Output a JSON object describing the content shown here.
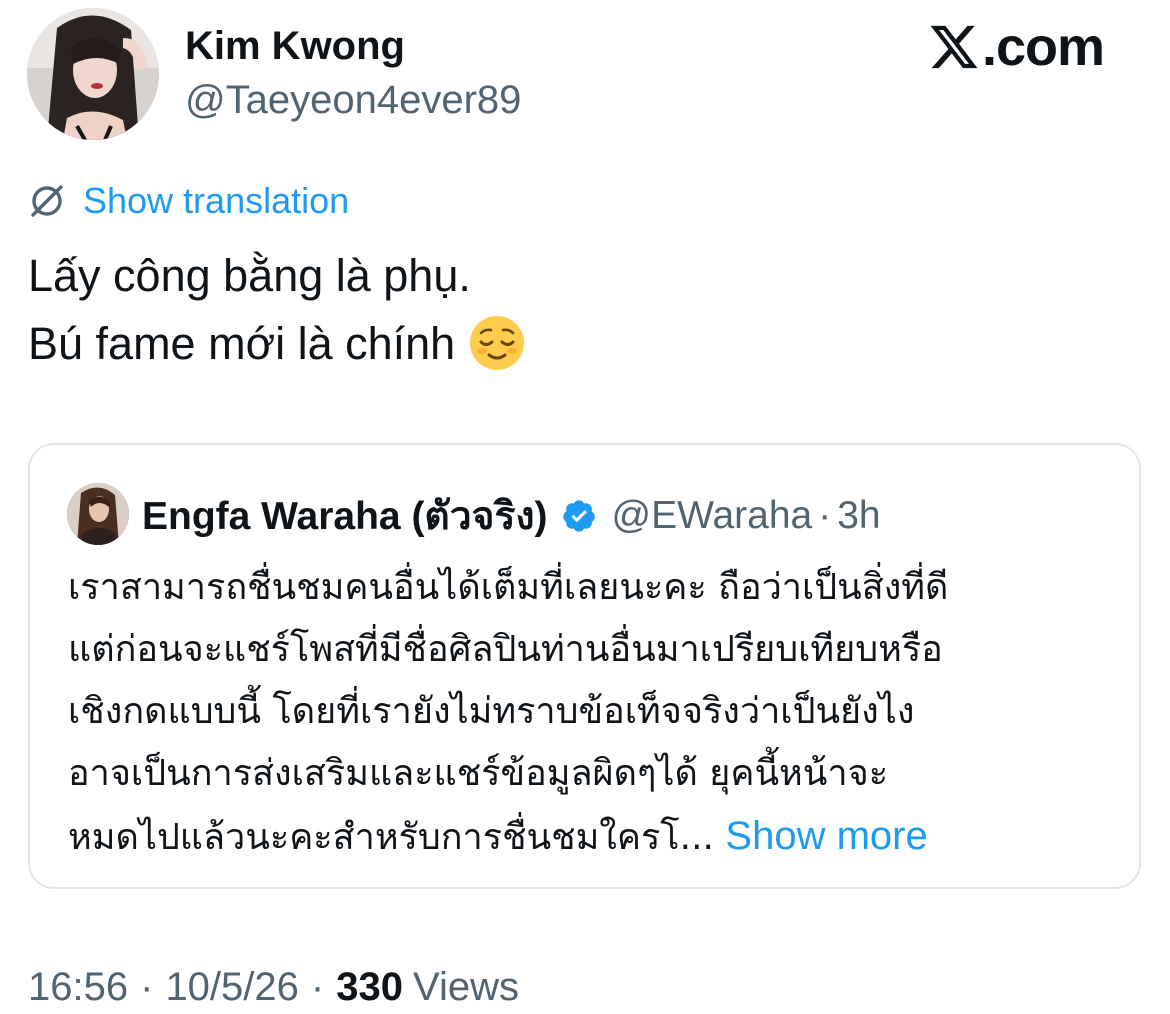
{
  "author": {
    "name": "Kim Kwong",
    "handle": "@Taeyeon4ever89"
  },
  "brand": {
    "site_label": ".com",
    "icon": "x-logo-icon"
  },
  "translation": {
    "label": "Show translation",
    "icon": "translate-globe-icon"
  },
  "tweet": {
    "lines": [
      "Lấy công bằng là phụ.",
      "Bú fame mới là chính"
    ],
    "emoji": "relieved-face-emoji"
  },
  "quote": {
    "name": "Engfa Waraha (ตัวจริง)",
    "verified": true,
    "handle": "@EWaraha",
    "separator": "·",
    "time": "3h",
    "lines": [
      "เราสามารถชื่นชมคนอื่นได้เต็มที่เลยนะคะ ถือว่าเป็นสิ่งที่ดี",
      "แต่ก่อนจะแชร์โพสที่มีชื่อศิลปินท่านอื่นมาเปรียบเทียบหรือ",
      "เชิงกดแบบนี้ โดยที่เรายังไม่ทราบข้อเท็จจริงว่าเป็นยังไง",
      "อาจเป็นการส่งเสริมและแชร์ข้อมูลผิดๆได้  ยุคนี้หน้าจะ",
      "หมดไปแล้วนะคะสำหรับการชื่นชมใครโ..."
    ],
    "show_more": "Show more"
  },
  "footer": {
    "time": "16:56",
    "date": "10/5/26",
    "separator": "·",
    "views_count": "330",
    "views_label": "Views"
  },
  "colors": {
    "link": "#1d9bf0",
    "secondary_text": "#536471",
    "primary_text": "#0f1419",
    "verified_badge": "#1d9bf0",
    "card_border": "#e1e6ea"
  }
}
